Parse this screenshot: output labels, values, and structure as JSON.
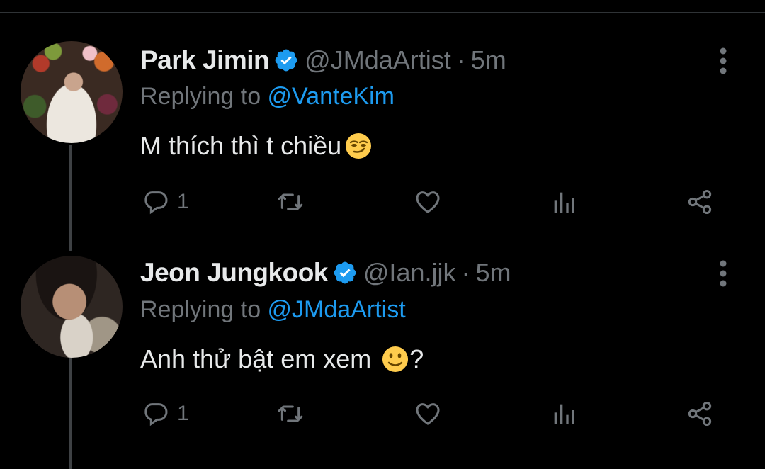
{
  "tweets": [
    {
      "name": "Park Jimin",
      "handle": "@JMdaArtist",
      "separator": "·",
      "time": "5m",
      "replying_prefix": "Replying to ",
      "replying_to": "@VanteKim",
      "text": "M thích thì t chiều",
      "emoji": "smirking-face",
      "text_suffix": "",
      "reply_count": "1",
      "retweet_count": "",
      "like_count": ""
    },
    {
      "name": "Jeon Jungkook",
      "handle": "@Ian.jjk",
      "separator": "·",
      "time": "5m",
      "replying_prefix": "Replying to ",
      "replying_to": "@JMdaArtist",
      "text": "Anh thử bật em xem ",
      "emoji": "slightly-smiling-face",
      "text_suffix": "?",
      "reply_count": "1",
      "retweet_count": "",
      "like_count": ""
    }
  ],
  "colors": {
    "background": "#000000",
    "primary_text": "#e7e9ea",
    "secondary_text": "#71767b",
    "accent": "#1d9bf0",
    "thread_line": "#3e4144"
  }
}
